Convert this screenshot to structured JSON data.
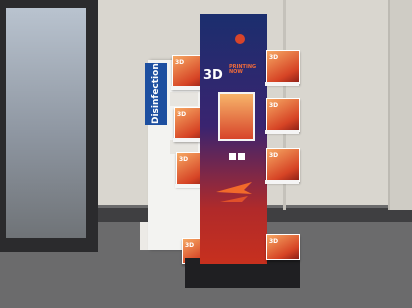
{
  "scene": {
    "rear_sign_text": "Disinfection",
    "stand_logo_big": "3D",
    "stand_logo_small_line1": "PRINTING",
    "stand_logo_small_line2": "NOW",
    "brochure_label": "3D",
    "colors": {
      "stand_top": "#1b2e6e",
      "stand_bottom": "#c7301e",
      "brochure": "#d64425",
      "sign_blue": "#1d4fa0"
    }
  }
}
